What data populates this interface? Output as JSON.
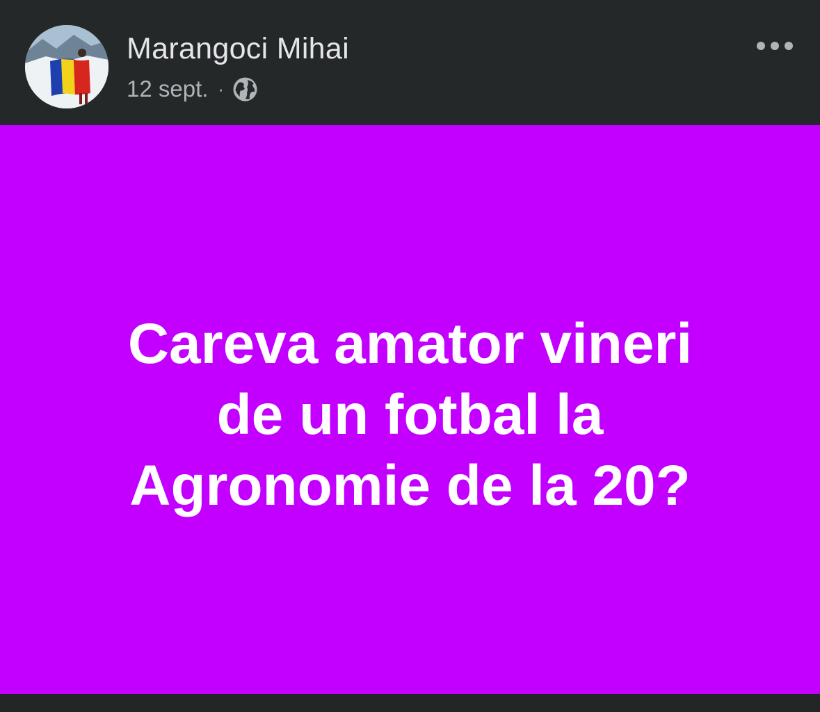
{
  "post": {
    "author": "Marangoci Mihai",
    "date": "12 sept.",
    "separator": "·",
    "audience_icon": "globe-icon",
    "more_icon": "more-options-icon",
    "background_color": "#c300ff",
    "text_lines": [
      "Careva amator vineri",
      "de un fotbal la",
      "Agronomie de la 20?"
    ]
  }
}
